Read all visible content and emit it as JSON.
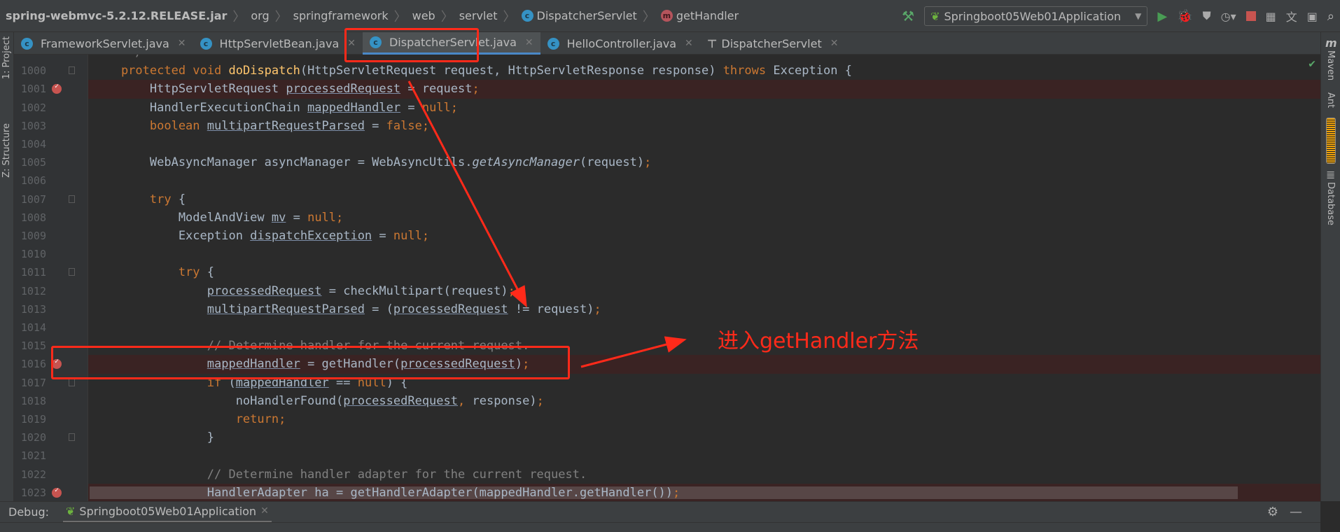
{
  "breadcrumbs": [
    {
      "label": "spring-webmvc-5.2.12.RELEASE.jar",
      "icon": ""
    },
    {
      "label": "org",
      "icon": ""
    },
    {
      "label": "springframework",
      "icon": ""
    },
    {
      "label": "web",
      "icon": ""
    },
    {
      "label": "servlet",
      "icon": ""
    },
    {
      "label": "DispatcherServlet",
      "icon": "class-icon"
    },
    {
      "label": "getHandler",
      "icon": "method-icon"
    }
  ],
  "toolbar": {
    "run_config": "Springboot05Web01Application"
  },
  "tabs": [
    {
      "label": "FrameworkServlet.java",
      "active": false
    },
    {
      "label": "HttpServletBean.java",
      "active": false
    },
    {
      "label": "DispatcherServlet.java",
      "active": true
    },
    {
      "label": "HelloController.java",
      "active": false
    },
    {
      "label": "DispatcherServlet",
      "active": false
    }
  ],
  "left_strip": {
    "project": "1: Project",
    "structure": "Z: Structure"
  },
  "right_strip": {
    "maven": "Maven",
    "ant": "Ant",
    "database": "Database"
  },
  "code": [
    {
      "n": "",
      "bp": false,
      "t": [
        [
          "     */",
          "c"
        ]
      ]
    },
    {
      "n": "1000",
      "bp": false,
      "fold": true,
      "t": [
        [
          "    protected void ",
          "k"
        ],
        [
          "doDispatch",
          "f"
        ],
        [
          "(HttpServletRequest request, HttpServletResponse response) ",
          "p"
        ],
        [
          "throws ",
          "k"
        ],
        [
          "Exception {",
          "p"
        ]
      ]
    },
    {
      "n": "1001",
      "bp": true,
      "t": [
        [
          "        HttpServletRequest ",
          "p"
        ],
        [
          "processedRequest",
          "u"
        ],
        [
          " = request",
          "p"
        ],
        [
          ";",
          "k"
        ]
      ]
    },
    {
      "n": "1002",
      "bp": false,
      "t": [
        [
          "        HandlerExecutionChain ",
          "p"
        ],
        [
          "mappedHandler",
          "u"
        ],
        [
          " = ",
          "p"
        ],
        [
          "null;",
          "k"
        ]
      ]
    },
    {
      "n": "1003",
      "bp": false,
      "t": [
        [
          "        boolean ",
          "k"
        ],
        [
          "multipartRequestParsed",
          "u"
        ],
        [
          " = ",
          "p"
        ],
        [
          "false;",
          "k"
        ]
      ]
    },
    {
      "n": "1004",
      "bp": false,
      "t": []
    },
    {
      "n": "1005",
      "bp": false,
      "t": [
        [
          "        WebAsyncManager asyncManager = WebAsyncUtils.",
          "p"
        ],
        [
          "getAsyncManager",
          "i"
        ],
        [
          "(request)",
          "p"
        ],
        [
          ";",
          "k"
        ]
      ]
    },
    {
      "n": "1006",
      "bp": false,
      "t": []
    },
    {
      "n": "1007",
      "bp": false,
      "fold": true,
      "t": [
        [
          "        try ",
          "k"
        ],
        [
          "{",
          "p"
        ]
      ]
    },
    {
      "n": "1008",
      "bp": false,
      "t": [
        [
          "            ModelAndView ",
          "p"
        ],
        [
          "mv",
          "u"
        ],
        [
          " = ",
          "p"
        ],
        [
          "null;",
          "k"
        ]
      ]
    },
    {
      "n": "1009",
      "bp": false,
      "t": [
        [
          "            Exception ",
          "p"
        ],
        [
          "dispatchException",
          "u"
        ],
        [
          " = ",
          "p"
        ],
        [
          "null;",
          "k"
        ]
      ]
    },
    {
      "n": "1010",
      "bp": false,
      "t": []
    },
    {
      "n": "1011",
      "bp": false,
      "fold": true,
      "t": [
        [
          "            try ",
          "k"
        ],
        [
          "{",
          "p"
        ]
      ]
    },
    {
      "n": "1012",
      "bp": false,
      "t": [
        [
          "                ",
          "p"
        ],
        [
          "processedRequest",
          "u"
        ],
        [
          " = checkMultipart(request)",
          "p"
        ],
        [
          ";",
          "k"
        ]
      ]
    },
    {
      "n": "1013",
      "bp": false,
      "t": [
        [
          "                ",
          "p"
        ],
        [
          "multipartRequestParsed",
          "u"
        ],
        [
          " = (",
          "p"
        ],
        [
          "processedRequest",
          "u"
        ],
        [
          " != request)",
          "p"
        ],
        [
          ";",
          "k"
        ]
      ]
    },
    {
      "n": "1014",
      "bp": false,
      "t": []
    },
    {
      "n": "1015",
      "bp": false,
      "t": [
        [
          "                // Determine handler for the current request.",
          "c"
        ]
      ]
    },
    {
      "n": "1016",
      "bp": true,
      "t": [
        [
          "                ",
          "p"
        ],
        [
          "mappedHandler",
          "u"
        ],
        [
          " = getHandler(",
          "p"
        ],
        [
          "processedRequest",
          "u"
        ],
        [
          ")",
          "p"
        ],
        [
          ";",
          "k"
        ]
      ]
    },
    {
      "n": "1017",
      "bp": false,
      "fold": true,
      "t": [
        [
          "                if ",
          "k"
        ],
        [
          "(",
          "p"
        ],
        [
          "mappedHandler",
          "u"
        ],
        [
          " == ",
          "p"
        ],
        [
          "null",
          "k"
        ],
        [
          ") {",
          "p"
        ]
      ]
    },
    {
      "n": "1018",
      "bp": false,
      "t": [
        [
          "                    noHandlerFound(",
          "p"
        ],
        [
          "processedRequest",
          "u"
        ],
        [
          ", ",
          "k"
        ],
        [
          "response)",
          "p"
        ],
        [
          ";",
          "k"
        ]
      ]
    },
    {
      "n": "1019",
      "bp": false,
      "t": [
        [
          "                    return;",
          "k"
        ]
      ]
    },
    {
      "n": "1020",
      "bp": false,
      "fold": true,
      "t": [
        [
          "                }",
          "p"
        ]
      ]
    },
    {
      "n": "1021",
      "bp": false,
      "t": []
    },
    {
      "n": "1022",
      "bp": false,
      "t": [
        [
          "                // Determine handler adapter for the current request.",
          "c"
        ]
      ]
    },
    {
      "n": "1023",
      "bp": true,
      "sel": true,
      "t": [
        [
          "                HandlerAdapter ha = getHandlerAdapter(mappedHandler.getHandler())",
          "p"
        ],
        [
          ";",
          "k"
        ]
      ]
    }
  ],
  "debug": {
    "label": "Debug:",
    "session": "Springboot05Web01Application"
  },
  "annotation": {
    "text": "进入getHandler方法",
    "color": "#ff2a1a"
  },
  "colors": {
    "keyword": "#cc7832",
    "function": "#ffc66d",
    "text": "#a9b7c6",
    "comment": "#808080",
    "breakpoint": "#c75450",
    "background": "#2b2b2b"
  }
}
